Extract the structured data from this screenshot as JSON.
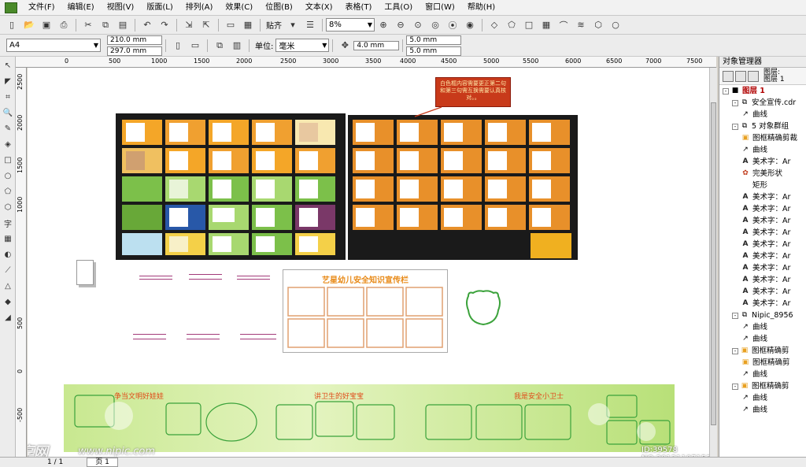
{
  "menu": [
    "文件(F)",
    "编辑(E)",
    "视图(V)",
    "版面(L)",
    "排列(A)",
    "效果(C)",
    "位图(B)",
    "文本(X)",
    "表格(T)",
    "工具(O)",
    "窗口(W)",
    "帮助(H)"
  ],
  "toolbar": {
    "zoom": "8%",
    "snap_label": "贴齐"
  },
  "property_bar": {
    "paper": "A4",
    "width": "210.0 mm",
    "height": "297.0 mm",
    "unit_label": "单位:",
    "unit_value": "毫米",
    "nudge": "4.0 mm",
    "dup_x": "5.0 mm",
    "dup_y": "5.0 mm"
  },
  "ruler": {
    "h_ticks": [
      "0",
      "500",
      "1000",
      "1500",
      "2000",
      "2500",
      "3000",
      "3500",
      "4000",
      "4500",
      "5000",
      "5500",
      "6000",
      "6500",
      "7000",
      "7500"
    ],
    "v_ticks": [
      "2500",
      "2000",
      "1500",
      "1000",
      "500",
      "0",
      "-500"
    ],
    "unit": "毫米"
  },
  "canvas": {
    "note_text": "白色框内容需要更正第二句和第三句需互换需要认真核对。。",
    "poster_title": "艺星幼儿安全知识宣传栏",
    "banner_texts": [
      "争当文明好娃娃",
      "讲卫生的好宝宝",
      "我是安全小卫士"
    ],
    "watermark": "昵享网",
    "watermark_url": "www.nipic.com",
    "id_text": "ID:39578 NO:20121107152751073388"
  },
  "object_manager": {
    "title": "对象管理器",
    "layer_header": [
      "图层:",
      "图层 1"
    ],
    "items": [
      {
        "level": 0,
        "label": "图层 1",
        "icon": "layer-icon",
        "expand": "-"
      },
      {
        "level": 1,
        "label": "安全宣传.cdr",
        "icon": "group-icon",
        "expand": "-"
      },
      {
        "level": 2,
        "label": "曲线",
        "icon": "curve-icon"
      },
      {
        "level": 1,
        "label": "5 对象群组",
        "icon": "group-icon",
        "expand": "-"
      },
      {
        "level": 2,
        "label": "图框精确剪裁",
        "icon": "frame-icon"
      },
      {
        "level": 2,
        "label": "曲线",
        "icon": "curve-icon"
      },
      {
        "level": 2,
        "label": "美术字：Ar",
        "icon": "text-icon"
      },
      {
        "level": 2,
        "label": "完美形状",
        "icon": "shape-icon"
      },
      {
        "level": 2,
        "label": "矩形",
        "icon": "rect-icon"
      },
      {
        "level": 2,
        "label": "美术字：Ar",
        "icon": "text-icon"
      },
      {
        "level": 2,
        "label": "美术字：Ar",
        "icon": "text-icon"
      },
      {
        "level": 2,
        "label": "美术字：Ar",
        "icon": "text-icon"
      },
      {
        "level": 2,
        "label": "美术字：Ar",
        "icon": "text-icon"
      },
      {
        "level": 2,
        "label": "美术字：Ar",
        "icon": "text-icon"
      },
      {
        "level": 2,
        "label": "美术字：Ar",
        "icon": "text-icon"
      },
      {
        "level": 2,
        "label": "美术字：Ar",
        "icon": "text-icon"
      },
      {
        "level": 2,
        "label": "美术字：Ar",
        "icon": "text-icon"
      },
      {
        "level": 2,
        "label": "美术字：Ar",
        "icon": "text-icon"
      },
      {
        "level": 2,
        "label": "美术字：Ar",
        "icon": "text-icon"
      },
      {
        "level": 1,
        "label": "Nipic_8956",
        "icon": "group-icon",
        "expand": "-"
      },
      {
        "level": 2,
        "label": "曲线",
        "icon": "curve-icon"
      },
      {
        "level": 2,
        "label": "曲线",
        "icon": "curve-icon"
      },
      {
        "level": 1,
        "label": "图框精确剪",
        "icon": "frame-icon",
        "expand": "-"
      },
      {
        "level": 2,
        "label": "图框精确剪",
        "icon": "frame-icon"
      },
      {
        "level": 2,
        "label": "曲线",
        "icon": "curve-icon"
      },
      {
        "level": 1,
        "label": "图框精确剪",
        "icon": "frame-icon",
        "expand": "-"
      },
      {
        "level": 2,
        "label": "曲线",
        "icon": "curve-icon"
      },
      {
        "level": 2,
        "label": "曲线",
        "icon": "curve-icon"
      }
    ]
  },
  "status": {
    "page_count": "1 / 1",
    "page_tab": "页 1"
  },
  "colors": {
    "layer_red": "#b00000",
    "note_red": "#c83a1a",
    "banner_green": "#a8d86a",
    "poster_orange": "#e89a2a"
  }
}
